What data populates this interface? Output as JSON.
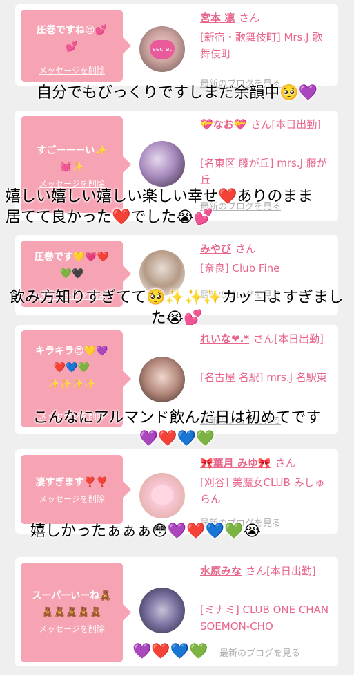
{
  "cards": [
    {
      "bubble_lines": [
        "圧巻ですね😍💕",
        "💕"
      ],
      "delete_label": "メッセージを削除",
      "name": "宮本 凛",
      "san": "さん",
      "store": "[新宿・歌舞伎町] Mrs.J 歌舞伎町",
      "blog_label": "最新のブログを見る",
      "avatar_text": "secret"
    },
    {
      "bubble_lines": [
        "すごーーーい✨",
        "💓✨"
      ],
      "delete_label": "メッセージを削除",
      "name": "💝なお💝",
      "san": "さん[本日出勤]",
      "store": "[名東区 藤が丘] mrs.J 藤が丘",
      "blog_label": "最新のブログを見る"
    },
    {
      "bubble_lines": [
        "圧巻です💛💗❤️",
        "💚🖤"
      ],
      "delete_label": "メッセージを削除",
      "name": "みやび",
      "san": "さん",
      "store": "[奈良] Club Fine",
      "blog_label": "最新のブログを見る"
    },
    {
      "bubble_lines": [
        "キラキラ😍💛💜",
        "❤️💙💚",
        "✨✨✨✨"
      ],
      "delete_label": "メッセージを削除",
      "name": "れいな❤︎.*",
      "san": "さん[本日出勤]",
      "store": "[名古屋 名駅] mrs.J 名駅東",
      "blog_label": "最新のブログを見る"
    },
    {
      "bubble_lines": [
        "凄すぎます❣️❣️"
      ],
      "delete_label": "メッセージを削除",
      "name": "🎀華月 みゆ🎀",
      "san": "さん",
      "store": "[刈谷] 美魔女CLUB みしゅらん",
      "blog_label": "最新のブログを見る"
    },
    {
      "bubble_lines": [
        "スーパーいーね🧸",
        "🧸🧸🧸🧸🧸"
      ],
      "delete_label": "メッセージを削除",
      "name": "水原みな",
      "san": "さん[本日出勤]",
      "store": "[ミナミ] CLUB ONE CHAN SOEMON-CHO",
      "blog_label": "最新のブログを見る"
    }
  ],
  "comments": [
    "自分でもびっくりですしまだ余韻中🥺💜",
    "嬉しい嬉しい嬉しい楽しい幸せ❤️ありのまま居てて良かった❤️でした😭💕",
    "飲み方知りすぎてて🥺✨✨✨カッコよすぎました😭💕",
    "こんなにアルマンド飲んだ日は初めてです",
    "💜❤️💙💚",
    "嬉しかったぁぁぁ😳💜❤️💙💚😭",
    "💜❤️💙💚"
  ]
}
